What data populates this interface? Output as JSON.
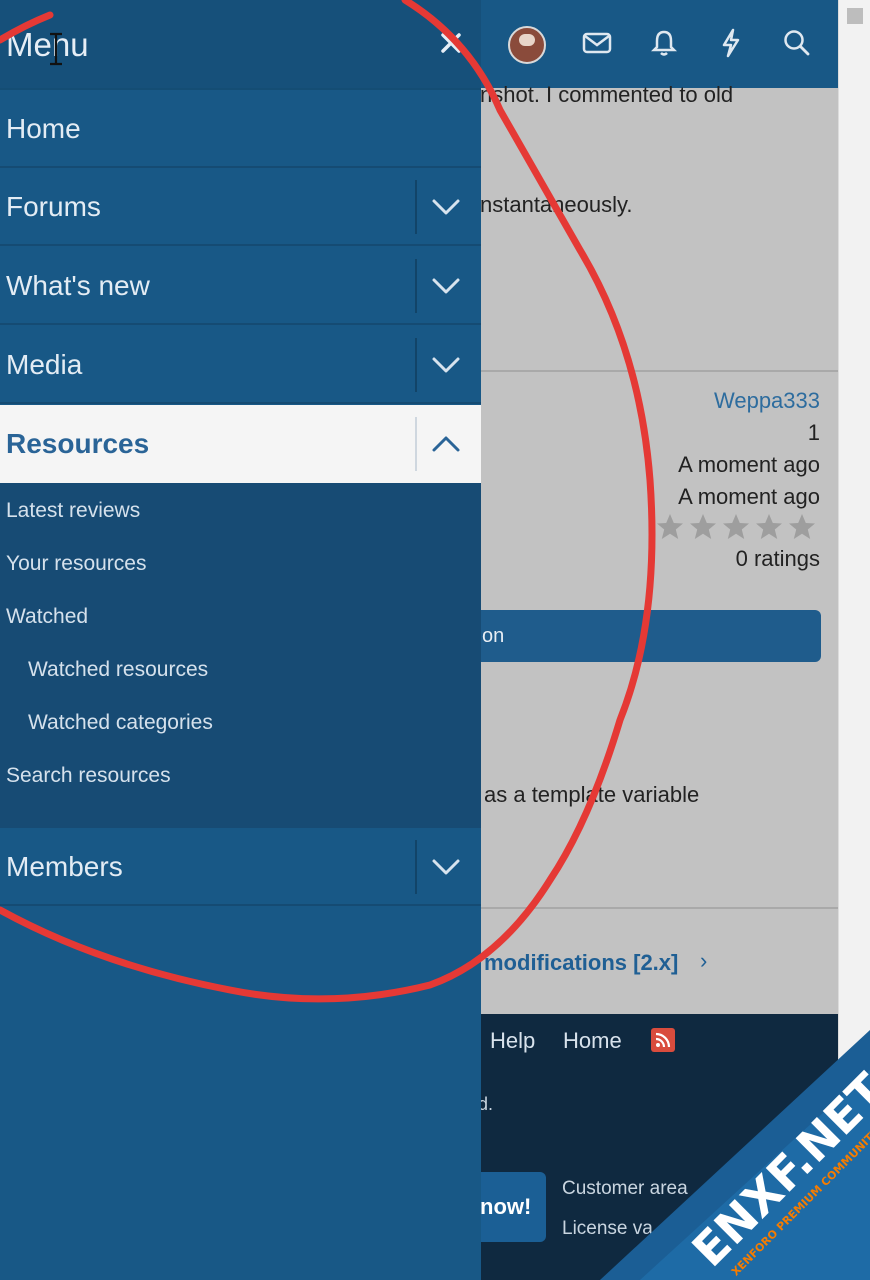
{
  "menu": {
    "title": "Menu",
    "items": [
      {
        "label": "Home"
      },
      {
        "label": "Forums"
      },
      {
        "label": "What's new"
      },
      {
        "label": "Media"
      },
      {
        "label": "Resources"
      },
      {
        "label": "Members"
      }
    ],
    "resources_submenu": [
      {
        "label": "Latest reviews"
      },
      {
        "label": "Your resources"
      },
      {
        "label": "Watched"
      },
      {
        "label": "Watched resources"
      },
      {
        "label": "Watched categories"
      },
      {
        "label": "Search resources"
      }
    ]
  },
  "background": {
    "text_line1": "nshot. I commented to old",
    "text_line2": "nstantaneously.",
    "author": "Weppa333",
    "count": "1",
    "time1": "A moment ago",
    "time2": "A moment ago",
    "ratings": "0 ratings",
    "button_label": "on",
    "text_line3": "as a template variable",
    "category_link": "modifications [2.x]",
    "category_chevron": "›",
    "footer_help": "Help",
    "footer_home": "Home",
    "footer_fragment": "d.",
    "now_button": "now!",
    "customer_area": "Customer area",
    "license": "License va"
  },
  "watermark": {
    "brand": "ENXF.NET",
    "tagline": "XENFORO PREMIUM COMMUNITY"
  },
  "colors": {
    "menu_bg": "#185886",
    "menu_active_bg": "#f5f5f5",
    "accent": "#2a6497",
    "annotation": "#e53935"
  },
  "icons": [
    "close-icon",
    "mail-icon",
    "bell-icon",
    "bolt-icon",
    "search-icon",
    "chevron-down-icon",
    "chevron-up-icon",
    "rss-icon",
    "star-icon"
  ]
}
